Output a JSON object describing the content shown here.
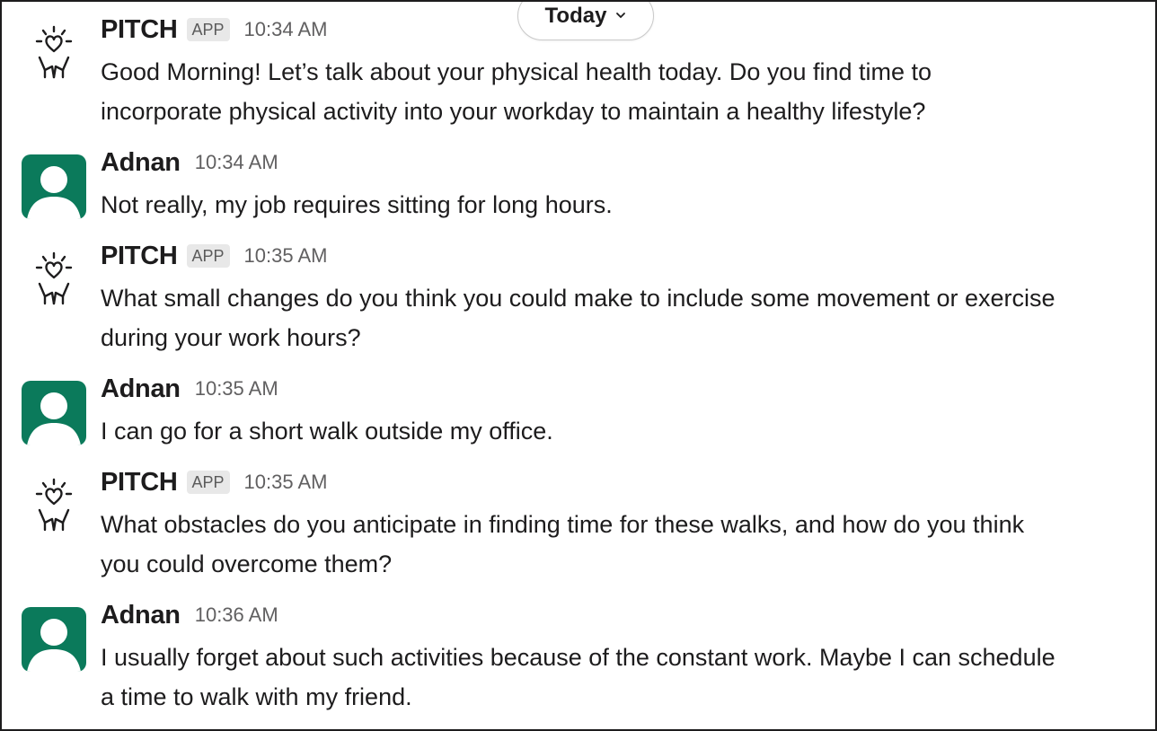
{
  "date_divider": {
    "label": "Today"
  },
  "messages": [
    {
      "sender": "PITCH",
      "badge": "APP",
      "time": "10:34 AM",
      "lines": [
        "Good Morning! Let’s talk about your physical health today. Do you find time to",
        "incorporate physical activity into your workday to maintain a healthy lifestyle?"
      ]
    },
    {
      "sender": "Adnan",
      "time": "10:34 AM",
      "lines": [
        "Not really, my job requires sitting for long hours."
      ]
    },
    {
      "sender": "PITCH",
      "badge": "APP",
      "time": "10:35 AM",
      "lines": [
        "What small changes do you think you could make to include some movement or exercise",
        "during your work hours?"
      ]
    },
    {
      "sender": "Adnan",
      "time": "10:35 AM",
      "lines": [
        "I can go for a short walk outside my office."
      ]
    },
    {
      "sender": "PITCH",
      "badge": "APP",
      "time": "10:35 AM",
      "lines": [
        "What obstacles do you anticipate in finding time for these walks, and how do you think",
        "you could overcome them?"
      ]
    },
    {
      "sender": "Adnan",
      "time": "10:36 AM",
      "lines": [
        "I usually forget about such activities because of the constant work. Maybe I can schedule",
        "a time to walk with my friend."
      ]
    }
  ],
  "colors": {
    "user_avatar": "#0b7a5b",
    "badge_bg": "#e8e8e8"
  },
  "icons": {
    "bot_avatar": "heart-raised-hands-icon",
    "user_avatar": "person-silhouette-icon",
    "date_chevron": "chevron-down-icon"
  }
}
